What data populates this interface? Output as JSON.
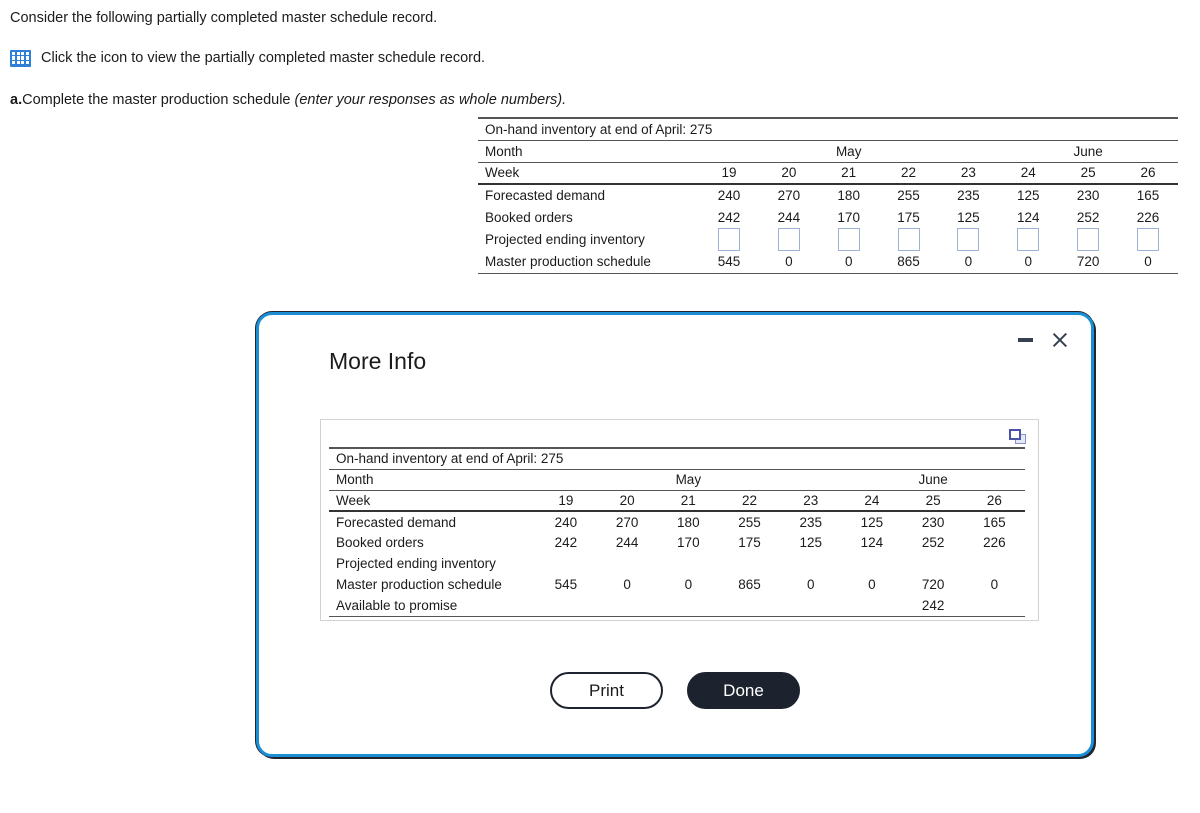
{
  "intro": {
    "line1": "Consider the following partially completed master schedule record.",
    "icon_line": "Click the icon to view the partially completed master schedule record.",
    "icon_name": "table-grid-icon",
    "question_label": "a.",
    "question_text": "Complete the master production schedule ",
    "question_italic": "(enter your responses as whole numbers)."
  },
  "main_table": {
    "title": "On-hand inventory at end of April: 275",
    "month_label": "Month",
    "months": [
      {
        "name": "May",
        "span": 5
      },
      {
        "name": "June",
        "span": 3
      }
    ],
    "week_label": "Week",
    "weeks": [
      "19",
      "20",
      "21",
      "22",
      "23",
      "24",
      "25",
      "26"
    ],
    "rows": [
      {
        "label": "Forecasted demand",
        "values": [
          "240",
          "270",
          "180",
          "255",
          "235",
          "125",
          "230",
          "165"
        ],
        "type": "text"
      },
      {
        "label": "Booked orders",
        "values": [
          "242",
          "244",
          "170",
          "175",
          "125",
          "124",
          "252",
          "226"
        ],
        "type": "text"
      },
      {
        "label": "Projected ending inventory",
        "values": [
          "",
          "",
          "",
          "",
          "",
          "",
          "",
          ""
        ],
        "type": "input"
      },
      {
        "label": "Master production schedule",
        "values": [
          "545",
          "0",
          "0",
          "865",
          "0",
          "0",
          "720",
          "0"
        ],
        "type": "text"
      }
    ]
  },
  "modal": {
    "title": "More Info",
    "minimize_label": "Minimize",
    "close_label": "Close",
    "copy_icon_name": "copy-window-icon",
    "table": {
      "title": "On-hand inventory at end of April: 275",
      "month_label": "Month",
      "months": [
        {
          "name": "May",
          "span": 5
        },
        {
          "name": "June",
          "span": 3
        }
      ],
      "week_label": "Week",
      "weeks": [
        "19",
        "20",
        "21",
        "22",
        "23",
        "24",
        "25",
        "26"
      ],
      "rows": [
        {
          "label": "Forecasted demand",
          "values": [
            "240",
            "270",
            "180",
            "255",
            "235",
            "125",
            "230",
            "165"
          ]
        },
        {
          "label": "Booked orders",
          "values": [
            "242",
            "244",
            "170",
            "175",
            "125",
            "124",
            "252",
            "226"
          ]
        },
        {
          "label": "Projected ending inventory",
          "values": [
            "",
            "",
            "",
            "",
            "",
            "",
            "",
            ""
          ]
        },
        {
          "label": "Master production schedule",
          "values": [
            "545",
            "0",
            "0",
            "865",
            "0",
            "0",
            "720",
            "0"
          ]
        },
        {
          "label": "Available to promise",
          "values": [
            "",
            "",
            "",
            "",
            "",
            "",
            "242",
            ""
          ]
        }
      ]
    },
    "print_label": "Print",
    "done_label": "Done"
  },
  "colors": {
    "modal_border": "#1b8ed6",
    "icon_blue": "#2f7ed8",
    "input_border": "#9db2d4",
    "done_button_bg": "#1d232e",
    "copy_icon": "#4a53a8"
  }
}
